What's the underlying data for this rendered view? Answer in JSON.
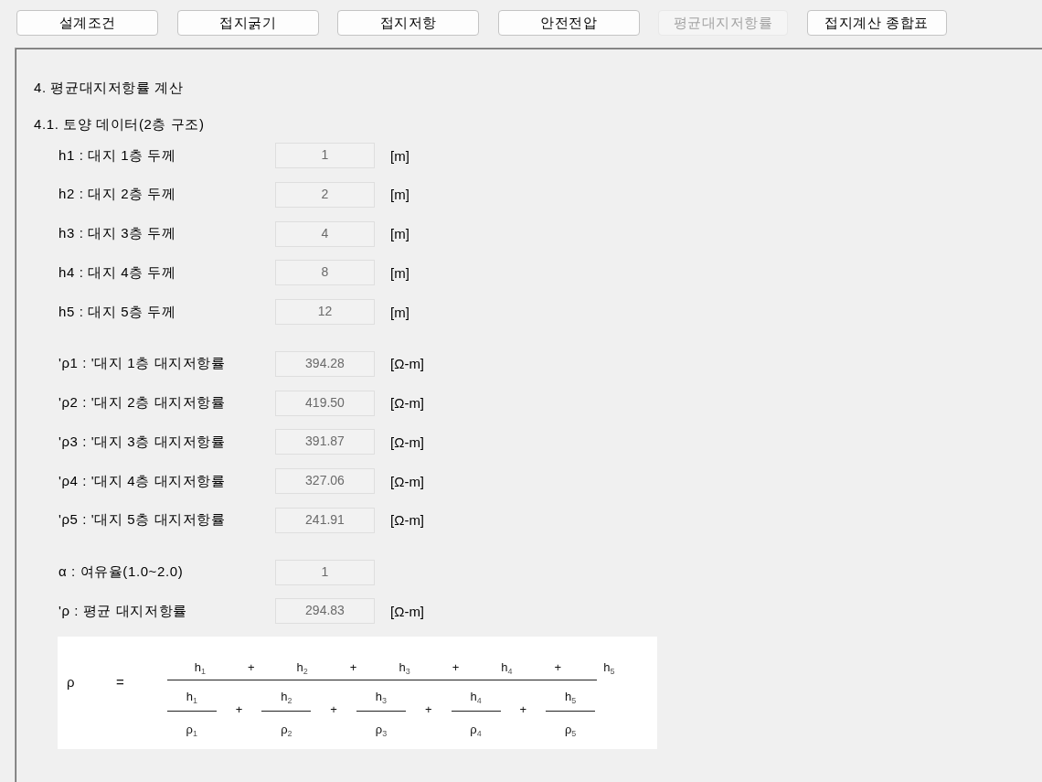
{
  "toolbar": [
    {
      "label": "설계조건",
      "disabled": false
    },
    {
      "label": "접지굵기",
      "disabled": false
    },
    {
      "label": "접지저항",
      "disabled": false
    },
    {
      "label": "안전전압",
      "disabled": false
    },
    {
      "label": "평균대지저항률",
      "disabled": true
    },
    {
      "label": "접지계산 종합표",
      "disabled": false
    }
  ],
  "panel": {
    "heading": "4. 평균대지저항률 계산",
    "subheading": "4.1. 토양 데이터(2층 구조)",
    "field_groups": [
      {
        "rows": [
          {
            "label": "h1 : 대지 1층 두께",
            "value": "1",
            "unit": "[m]"
          },
          {
            "label": "h2 : 대지 2층 두께",
            "value": "2",
            "unit": "[m]"
          },
          {
            "label": "h3 : 대지 3층 두께",
            "value": "4",
            "unit": "[m]"
          },
          {
            "label": "h4 : 대지 4층 두께",
            "value": "8",
            "unit": "[m]"
          },
          {
            "label": "h5 : 대지 5층 두께",
            "value": "12",
            "unit": "[m]"
          }
        ]
      },
      {
        "rows": [
          {
            "label": "'ρ1 : '대지 1층 대지저항률",
            "value": "394.28",
            "unit": "[Ω-m]"
          },
          {
            "label": "'ρ2 : '대지 2층 대지저항률",
            "value": "419.50",
            "unit": "[Ω-m]"
          },
          {
            "label": "'ρ3 : '대지 3층 대지저항률",
            "value": "391.87",
            "unit": "[Ω-m]"
          },
          {
            "label": "'ρ4 : '대지 4층 대지저항률",
            "value": "327.06",
            "unit": "[Ω-m]"
          },
          {
            "label": "'ρ5 : '대지 5층 대지저항률",
            "value": "241.91",
            "unit": "[Ω-m]"
          }
        ]
      },
      {
        "rows": [
          {
            "label": "α : 여유율(1.0~2.0)",
            "value": "1"
          },
          {
            "label": "'ρ : 평균 대지저항률",
            "value": "294.83",
            "unit": "[Ω-m]"
          }
        ]
      }
    ],
    "formula": {
      "symbol": "ρ",
      "equals": "=",
      "numerator": [
        {
          "kind": "term",
          "text": "h$_{1}$"
        },
        {
          "kind": "operator",
          "text": "+"
        },
        {
          "kind": "term",
          "text": "h$_{2}$"
        },
        {
          "kind": "operator",
          "text": "+"
        },
        {
          "kind": "term",
          "text": "h$_{3}$"
        },
        {
          "kind": "operator",
          "text": "+"
        },
        {
          "kind": "term",
          "text": "h$_{4}$"
        },
        {
          "kind": "operator",
          "text": "+"
        },
        {
          "kind": "term",
          "text": "h$_{5}$"
        }
      ],
      "denominator": [
        {
          "kind": "fraction",
          "top": "h$_{1}$",
          "bottom": "ρ$_{1}$"
        },
        {
          "kind": "operator",
          "text": "+"
        },
        {
          "kind": "fraction",
          "top": "h$_{2}$",
          "bottom": "ρ$_{2}$"
        },
        {
          "kind": "operator",
          "text": "+"
        },
        {
          "kind": "fraction",
          "top": "h$_{3}$",
          "bottom": "ρ$_{3}$"
        },
        {
          "kind": "operator",
          "text": "+"
        },
        {
          "kind": "fraction",
          "top": "h$_{4}$",
          "bottom": "ρ$_{4}$"
        },
        {
          "kind": "operator",
          "text": "+"
        },
        {
          "kind": "fraction",
          "top": "h$_{5}$",
          "bottom": "ρ$_{5}$"
        }
      ]
    }
  }
}
